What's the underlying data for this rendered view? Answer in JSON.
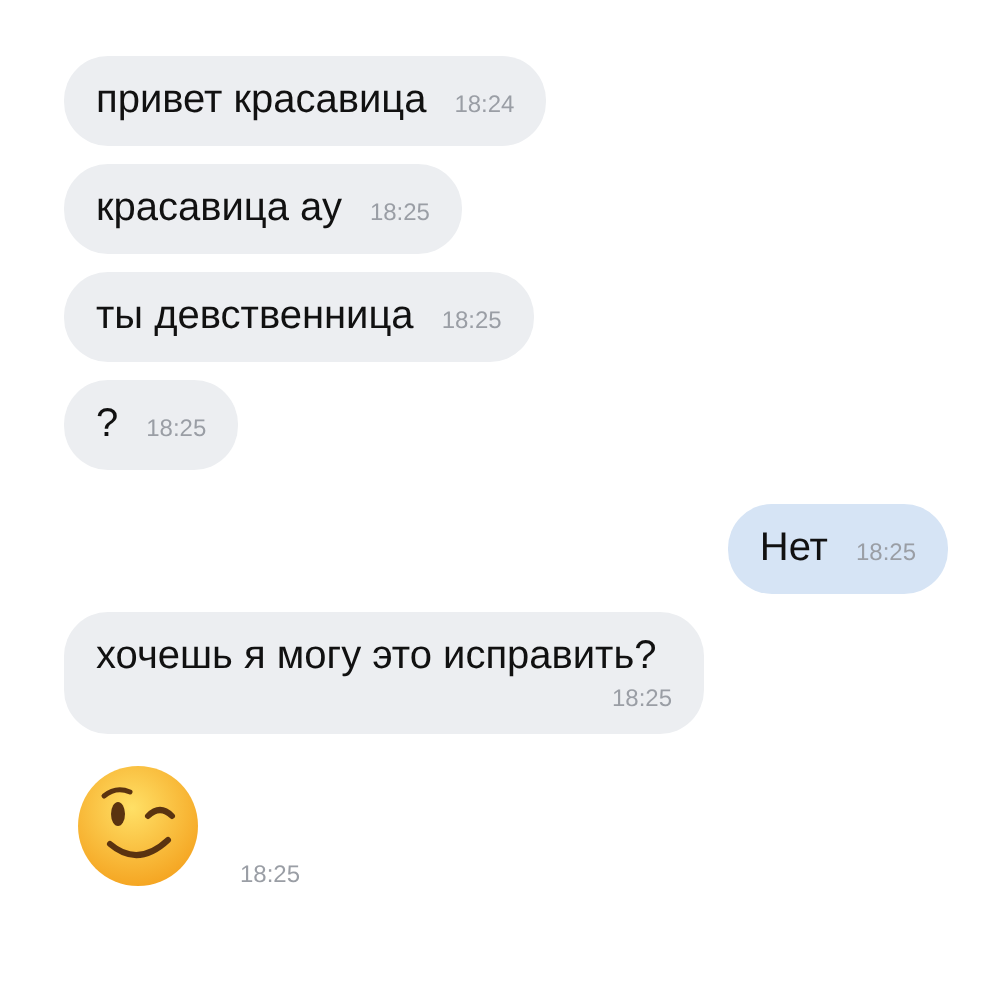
{
  "messages": [
    {
      "kind": "text",
      "outgoing": false,
      "text": "привет красавица",
      "time": "18:24"
    },
    {
      "kind": "text",
      "outgoing": false,
      "text": "красавица ау",
      "time": "18:25"
    },
    {
      "kind": "text",
      "outgoing": false,
      "text": "ты девственница",
      "time": "18:25"
    },
    {
      "kind": "text",
      "outgoing": false,
      "text": "?",
      "time": "18:25"
    },
    {
      "kind": "text",
      "outgoing": true,
      "text": "Нет",
      "time": "18:25"
    },
    {
      "kind": "text",
      "outgoing": false,
      "text": "хочешь я могу это исправить?",
      "time": "18:25"
    },
    {
      "kind": "emoji",
      "time": "18:25"
    }
  ]
}
